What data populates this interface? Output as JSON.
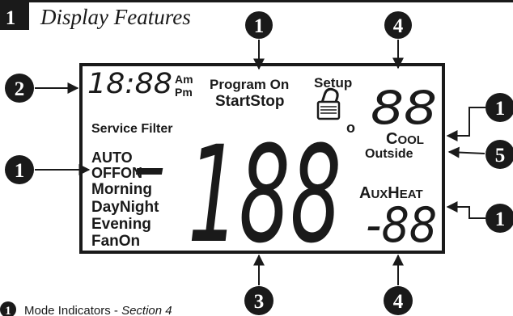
{
  "header": {
    "section_number": "1",
    "title": "Display Features"
  },
  "callouts": {
    "top_program": "1",
    "top_digits": "4",
    "left_clock": "2",
    "left_modes": "1",
    "right_cool": "1",
    "right_outside": "5",
    "right_auxheat": "1",
    "bottom_temp": "3",
    "bottom_outdoor": "4"
  },
  "lcd": {
    "clock": "18:88",
    "am": "Am",
    "pm": "Pm",
    "program_on": "Program On",
    "start_stop": "StartStop",
    "setup": "Setup",
    "set_digits": "88",
    "service_filter": "Service Filter",
    "big_temp": "188",
    "dash": "-",
    "degree": "o",
    "cool_c": "C",
    "cool_rest": "OOL",
    "outside": "Outside",
    "aux_a": "A",
    "aux_ux": "UX",
    "heat_h": "H",
    "heat_eat": "EAT",
    "outdoor_digits": "-88",
    "modes": [
      "AUTO",
      "OFFON",
      "Morning",
      "DayNight",
      "Evening",
      "FanOn"
    ]
  },
  "legend": {
    "item1_number": "1",
    "item1_text": "Mode Indicators - ",
    "item1_ref": "Section 4"
  },
  "colors": {
    "ink": "#1a1a1a",
    "background": "#ffffff"
  }
}
